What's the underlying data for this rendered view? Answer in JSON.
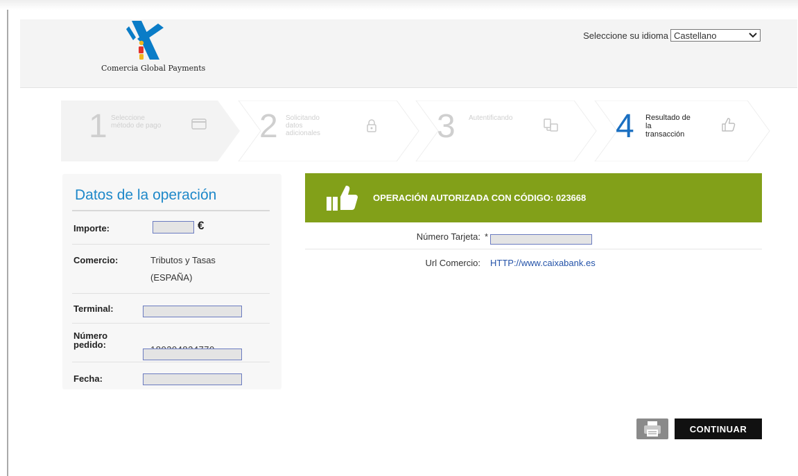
{
  "header": {
    "brand_name": "Comercia Global Payments",
    "language_label": "Seleccione su idioma",
    "language_selected": "Castellano"
  },
  "steps": [
    {
      "number": "1",
      "label": "Seleccione método de pago",
      "icon": "card-icon",
      "active": false
    },
    {
      "number": "2",
      "label": "Solicitando datos adicionales",
      "icon": "lock-icon",
      "active": false
    },
    {
      "number": "3",
      "label": "Autentificando",
      "icon": "devices-icon",
      "active": false
    },
    {
      "number": "4",
      "label_lines": [
        "Resultado de",
        "la",
        "transacción"
      ],
      "icon": "thumbs-up-icon",
      "active": true
    }
  ],
  "operation": {
    "title": "Datos de la operación",
    "fields": {
      "importe_label": "Importe:",
      "importe_currency": "€",
      "comercio_label": "Comercio:",
      "comercio_line1": "Tributos y Tasas",
      "comercio_line2": "(ESPAÑA)",
      "terminal_label": "Terminal:",
      "pedido_label_line1": "Número",
      "pedido_label_line2": "pedido:",
      "pedido_value": "180204824770",
      "fecha_label": "Fecha:"
    }
  },
  "result": {
    "banner_text": "OPERACIÓN AUTORIZADA CON CÓDIGO: 023668",
    "banner_color": "#82a019",
    "card_label": "Número Tarjeta:",
    "card_value_prefix": "*",
    "url_label": "Url Comercio:",
    "url_value": "HTTP://www.caixabank.es"
  },
  "actions": {
    "continue_label": "CONTINUAR"
  }
}
